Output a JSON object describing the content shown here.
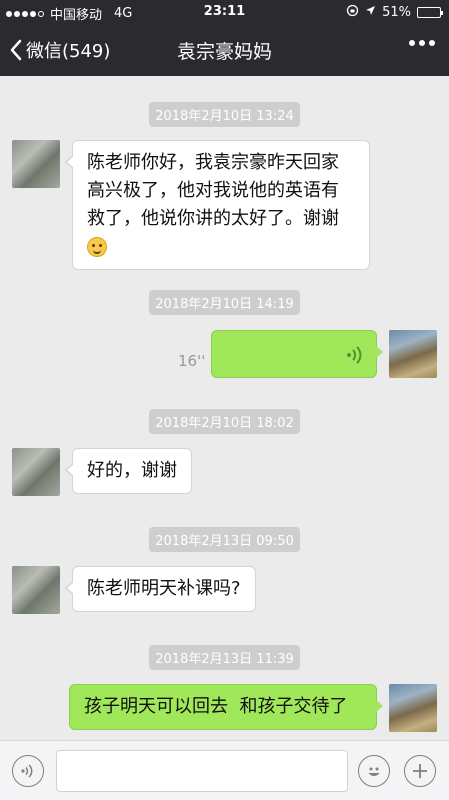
{
  "status_bar": {
    "carrier": "中国移动",
    "network": "4G",
    "time": "23:11",
    "battery_percent": "51%",
    "battery_level": 0.51,
    "signal_dots_filled": 4
  },
  "nav": {
    "back_label": "微信(549)",
    "title": "袁宗豪妈妈"
  },
  "messages": [
    {
      "timestamp": "2018年2月10日 13:24",
      "direction": "incoming",
      "text": "陈老师你好，我袁宗豪昨天回家高兴极了，他对我说他的英语有救了，他说你讲的太好了。谢谢",
      "emoji": "smile-emoji"
    },
    {
      "timestamp": "2018年2月10日 14:19",
      "direction": "outgoing",
      "type": "voice",
      "duration": "16''"
    },
    {
      "timestamp": "2018年2月10日 18:02",
      "direction": "incoming",
      "text": "好的，谢谢"
    },
    {
      "timestamp": "2018年2月13日 09:50",
      "direction": "incoming",
      "text": "陈老师明天补课吗?"
    },
    {
      "timestamp": "2018年2月13日 11:39",
      "direction": "outgoing",
      "text": "孩子明天可以回去  和孩子交待了"
    }
  ],
  "colors": {
    "header_bg": "#2b2b2f",
    "chat_bg": "#ebebeb",
    "outgoing_bubble": "#a0e75a",
    "incoming_bubble": "#ffffff",
    "timestamp_bg": "#cecece"
  }
}
